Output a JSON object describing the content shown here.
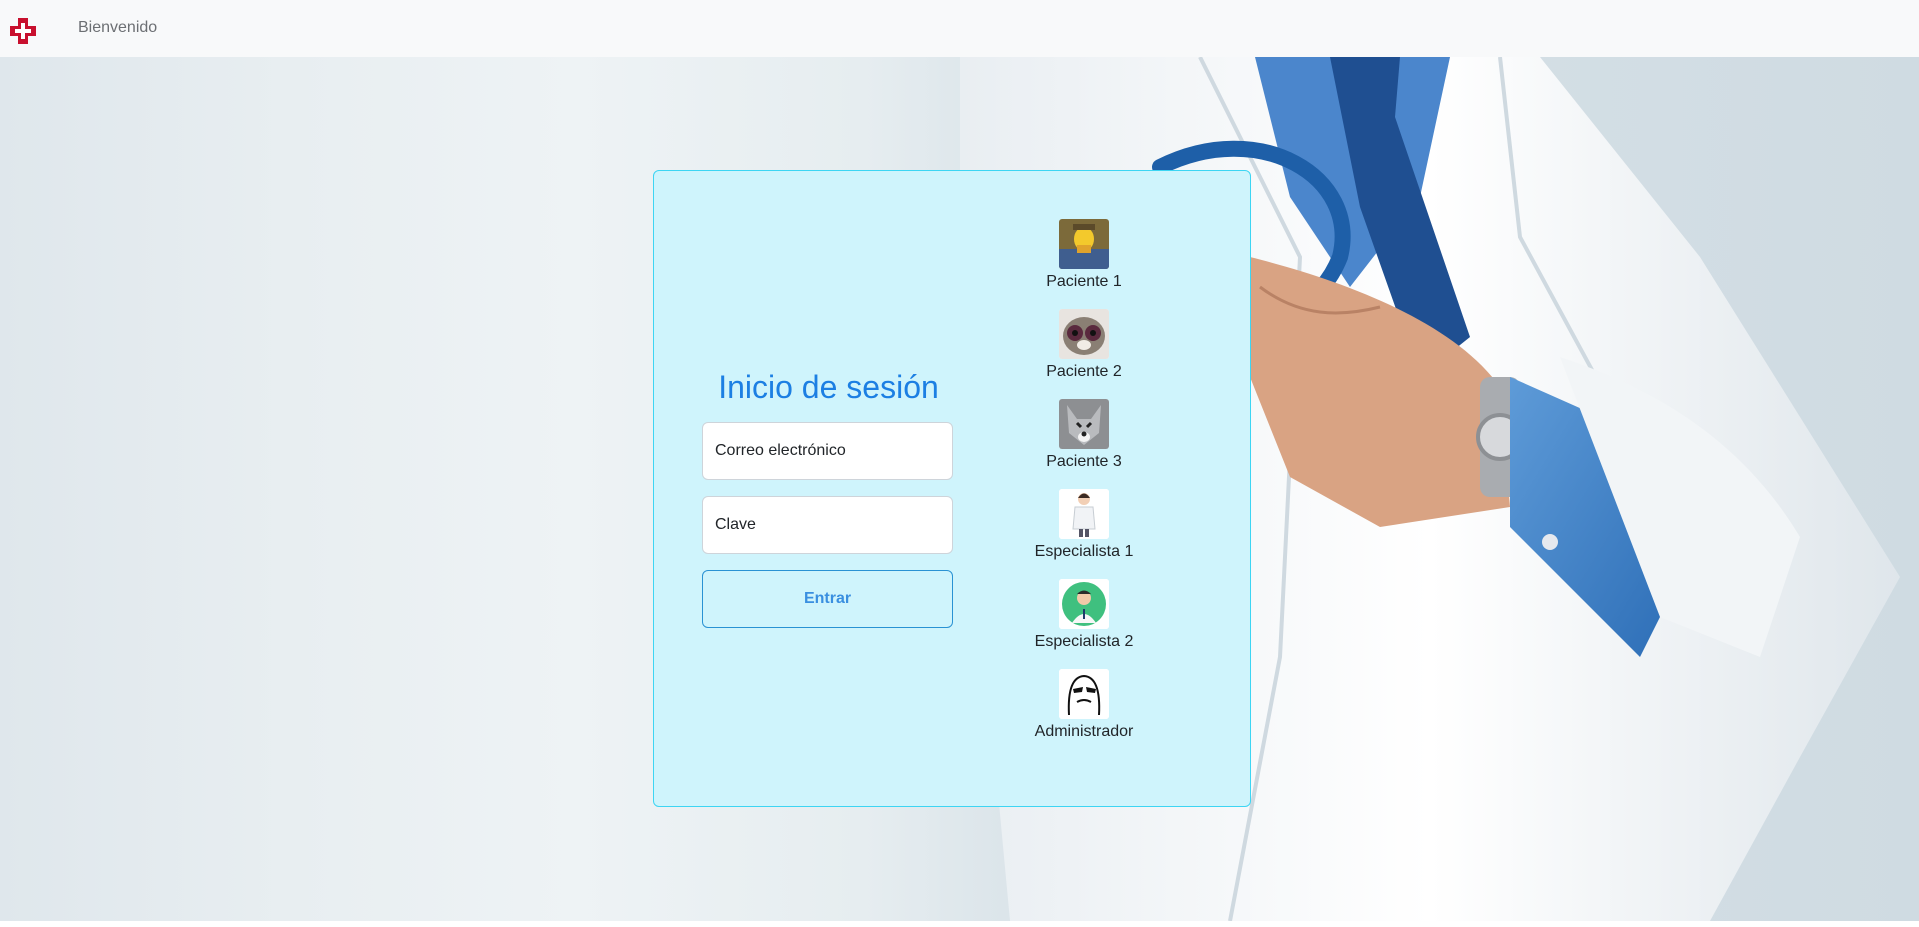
{
  "navbar": {
    "brand_icon": "red-cross-icon",
    "brand_color": "#c8102e",
    "link_label": "Bienvenido"
  },
  "login": {
    "title": "Inicio de sesión",
    "email_placeholder": "Correo electrónico",
    "password_placeholder": "Clave",
    "submit_label": "Entrar"
  },
  "quick_users": [
    {
      "label": "Paciente 1",
      "avatar": "cartoon-man-avatar"
    },
    {
      "label": "Paciente 2",
      "avatar": "cat-avatar"
    },
    {
      "label": "Paciente 3",
      "avatar": "wolf-avatar"
    },
    {
      "label": "Especialista 1",
      "avatar": "female-doctor-avatar"
    },
    {
      "label": "Especialista 2",
      "avatar": "male-doctor-avatar"
    },
    {
      "label": "Administrador",
      "avatar": "meme-face-avatar"
    }
  ],
  "colors": {
    "card_bg": "#cff4fc",
    "card_border": "#3dd5f3",
    "title": "#1c7fe3",
    "button_text": "#3a8fe0"
  }
}
